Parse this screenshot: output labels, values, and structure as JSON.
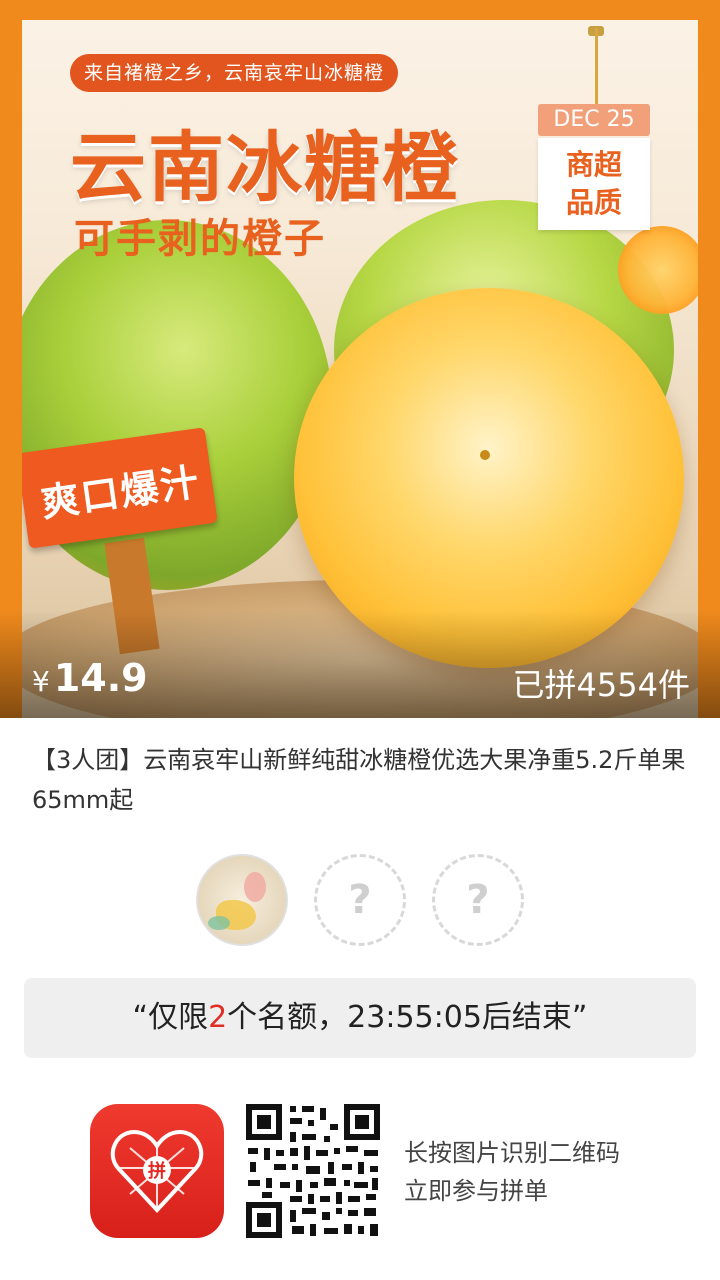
{
  "hero": {
    "tag_top": "来自褚橙之乡，云南哀牢山冰糖橙",
    "title": "云南冰糖橙",
    "subtitle": "可手剥的橙子",
    "date_tag": "DEC 25",
    "quality_line1": "商超",
    "quality_line2": "品质",
    "sign": "爽口爆汁",
    "price_symbol": "¥",
    "price": "14.9",
    "sold": "已拼4554件"
  },
  "product": {
    "description": "【3人团】云南哀牢山新鲜纯甜冰糖橙优选大果净重5.2斤单果65mm起"
  },
  "group": {
    "empty_slot_mark": "?",
    "notice_prefix": "“仅限",
    "notice_count": "2",
    "notice_suffix": "个名额，23:55:05后结束”"
  },
  "footer": {
    "qr_line1": "长按图片识别二维码",
    "qr_line2": "立即参与拼单",
    "logo_char": "拼"
  },
  "colors": {
    "brand_orange": "#f08a1c",
    "accent_red": "#e02e24",
    "pdd_red": "#e5271f"
  }
}
